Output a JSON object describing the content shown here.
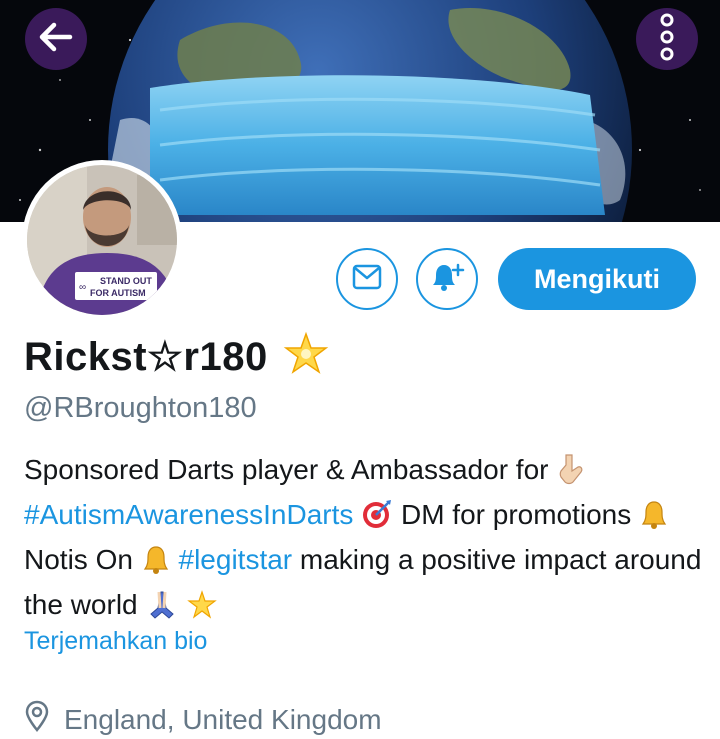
{
  "profile": {
    "display_name": "Rickst☆r180",
    "handle": "@RBroughton180",
    "follow_label": "Mengikuti",
    "avatar_shirt_text_1": "STAND OUT",
    "avatar_shirt_text_2": "FOR AUTISM",
    "bio": {
      "part1": "Sponsored Darts player & Ambassador for ",
      "hashtag1": "#AutismAwarenessInDarts",
      "part2": " DM for promotions",
      "part3": "Notis On",
      "hashtag2": "#legitstar",
      "part4": " making a positive impact around the world "
    },
    "translate_label": "Terjemahkan bio",
    "location": "England, United Kingdom"
  },
  "icons": {
    "back": "arrow-left-icon",
    "more": "more-vertical-icon",
    "message": "envelope-icon",
    "notify": "bell-plus-icon",
    "location": "map-pin-icon"
  },
  "colors": {
    "accent": "#1b95e0",
    "text": "#14171a",
    "muted": "#657786",
    "button_bg": "#3a1a5a"
  }
}
